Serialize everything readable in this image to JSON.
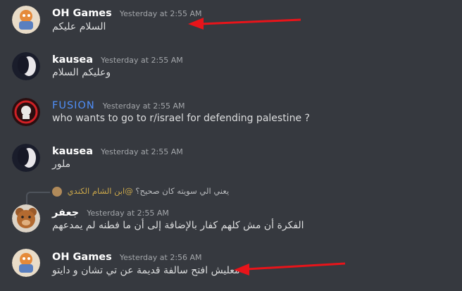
{
  "messages": [
    {
      "author": "OH Games",
      "timestamp": "Yesterday at 2:55 AM",
      "text": "السلام عليكم"
    },
    {
      "author": "kausea",
      "timestamp": "Yesterday at 2:55 AM",
      "text": "وعليكم السلام"
    },
    {
      "author": "FUSION",
      "timestamp": "Yesterday at 2:55 AM",
      "text": "who wants to go to r/israel for defending palestine ?"
    },
    {
      "author": "kausea",
      "timestamp": "Yesterday at 2:55 AM",
      "text": "ملور"
    },
    {
      "author": "جعفر",
      "timestamp": "Yesterday at 2:55 AM",
      "text": "الفكرة أن مش كلهم كفار بالإضافة إلى أن ما فطنه لم يمدعهم"
    },
    {
      "author": "OH Games",
      "timestamp": "Yesterday at 2:56 AM",
      "text": "معليش افتح سالفة قديمة عن تي تشان و دايتو"
    }
  ],
  "reply": {
    "mention": "@ابن الشام الكندي",
    "text": "يعني الي سويته كان صحيح؟"
  },
  "colors": {
    "background": "#36393f",
    "fusion_name": "#4f8ef7",
    "arrow": "#e8141a",
    "mention": "#c9a64a"
  }
}
